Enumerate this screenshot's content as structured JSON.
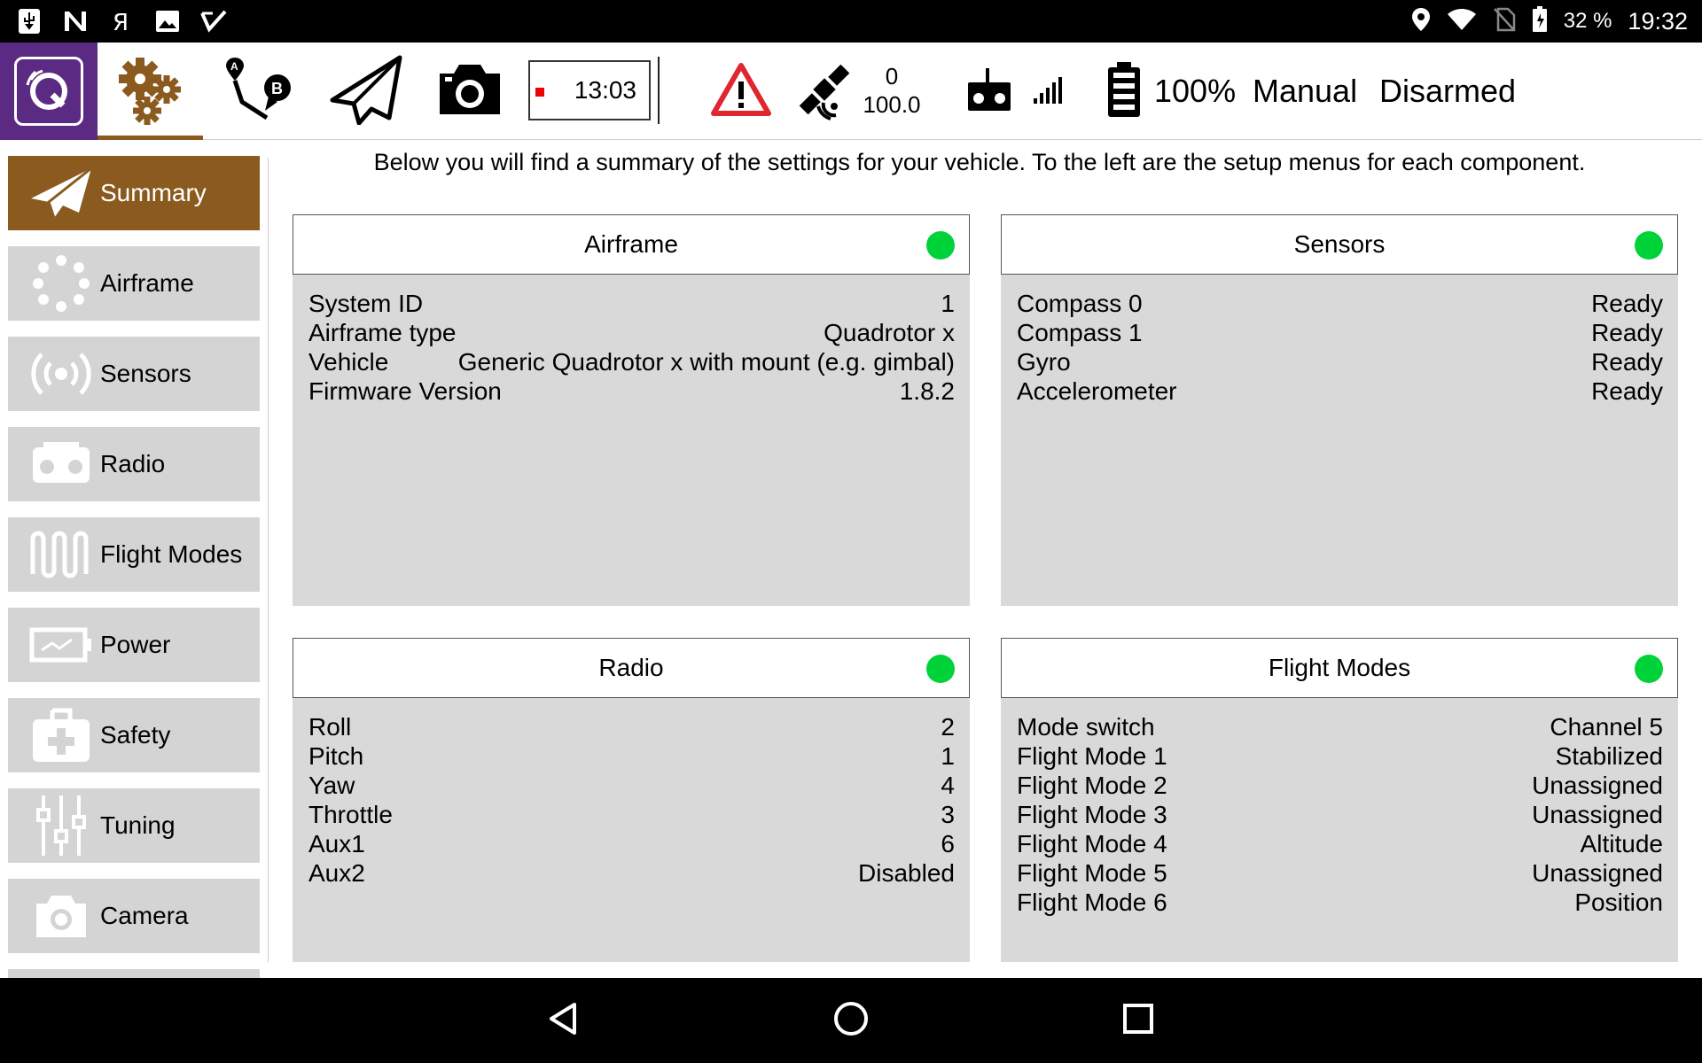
{
  "statusbar": {
    "left_icons": [
      "usb-icon",
      "n-icon",
      "yandex-icon",
      "image-icon",
      "check-icon"
    ],
    "battery_percent": "32 %",
    "time": "19:32"
  },
  "toolbar": {
    "timer": "13:03",
    "gps_count": "0",
    "gps_hdop": "100.0",
    "battery": "100%",
    "flight_mode": "Manual",
    "arm_state": "Disarmed"
  },
  "sidebar": {
    "items": [
      {
        "label": "Summary",
        "icon": "paper-plane-icon"
      },
      {
        "label": "Airframe",
        "icon": "airframe-icon"
      },
      {
        "label": "Sensors",
        "icon": "sensors-icon"
      },
      {
        "label": "Radio",
        "icon": "radio-icon"
      },
      {
        "label": "Flight Modes",
        "icon": "flight-modes-icon"
      },
      {
        "label": "Power",
        "icon": "power-icon"
      },
      {
        "label": "Safety",
        "icon": "safety-icon"
      },
      {
        "label": "Tuning",
        "icon": "tuning-icon"
      },
      {
        "label": "Camera",
        "icon": "camera-icon"
      }
    ]
  },
  "main": {
    "intro": "Below you will find a summary of the settings for your vehicle. To the left are the setup menus for each component.",
    "panels": {
      "airframe": {
        "title": "Airframe",
        "status_color": "#00d23a",
        "rows": [
          {
            "label": "System ID",
            "value": "1"
          },
          {
            "label": "Airframe type",
            "value": "Quadrotor x"
          },
          {
            "label": "Vehicle",
            "value": "Generic Quadrotor x with mount (e.g. gimbal)"
          },
          {
            "label": "Firmware Version",
            "value": "1.8.2"
          }
        ]
      },
      "sensors": {
        "title": "Sensors",
        "status_color": "#00d23a",
        "rows": [
          {
            "label": "Compass 0",
            "value": "Ready"
          },
          {
            "label": "Compass 1",
            "value": "Ready"
          },
          {
            "label": "Gyro",
            "value": "Ready"
          },
          {
            "label": "Accelerometer",
            "value": "Ready"
          }
        ]
      },
      "radio": {
        "title": "Radio",
        "status_color": "#00d23a",
        "rows": [
          {
            "label": "Roll",
            "value": "2"
          },
          {
            "label": "Pitch",
            "value": "1"
          },
          {
            "label": "Yaw",
            "value": "4"
          },
          {
            "label": "Throttle",
            "value": "3"
          },
          {
            "label": "Aux1",
            "value": "6"
          },
          {
            "label": "Aux2",
            "value": "Disabled"
          }
        ]
      },
      "flight_modes": {
        "title": "Flight Modes",
        "status_color": "#00d23a",
        "rows": [
          {
            "label": "Mode switch",
            "value": "Channel 5"
          },
          {
            "label": "Flight Mode 1",
            "value": "Stabilized"
          },
          {
            "label": "Flight Mode 2",
            "value": "Unassigned"
          },
          {
            "label": "Flight Mode 3",
            "value": "Unassigned"
          },
          {
            "label": "Flight Mode 4",
            "value": "Altitude"
          },
          {
            "label": "Flight Mode 5",
            "value": "Unassigned"
          },
          {
            "label": "Flight Mode 6",
            "value": "Position"
          }
        ]
      }
    }
  },
  "colors": {
    "brand": "#5b2a82",
    "accent": "#8a5a1e",
    "panel_bg": "#d9d9d9",
    "menu_bg": "#d4d4d4",
    "status_ok": "#00d23a",
    "warning": "#e0262e"
  }
}
